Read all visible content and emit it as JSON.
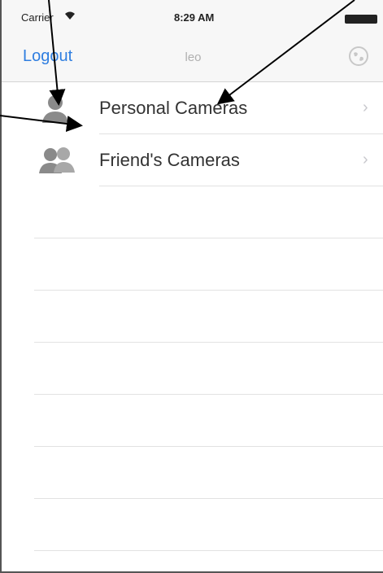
{
  "statusbar": {
    "carrier": "Carrier",
    "wifi_icon": "wifi-icon",
    "time": "8:29 AM",
    "battery_icon": "battery-icon"
  },
  "navbar": {
    "logout_label": "Logout",
    "title": "leo",
    "right_icon": "globe-icon"
  },
  "list": {
    "items": [
      {
        "label": "Personal Cameras",
        "icon": "single-user-icon",
        "accessory": "›"
      },
      {
        "label": "Friend's Cameras",
        "icon": "group-users-icon",
        "accessory": "›"
      }
    ]
  },
  "colors": {
    "accent": "#2f7ee0",
    "bar_background": "#f7f7f7",
    "separator": "#e2e2e2",
    "icon_gray": "#888888"
  }
}
